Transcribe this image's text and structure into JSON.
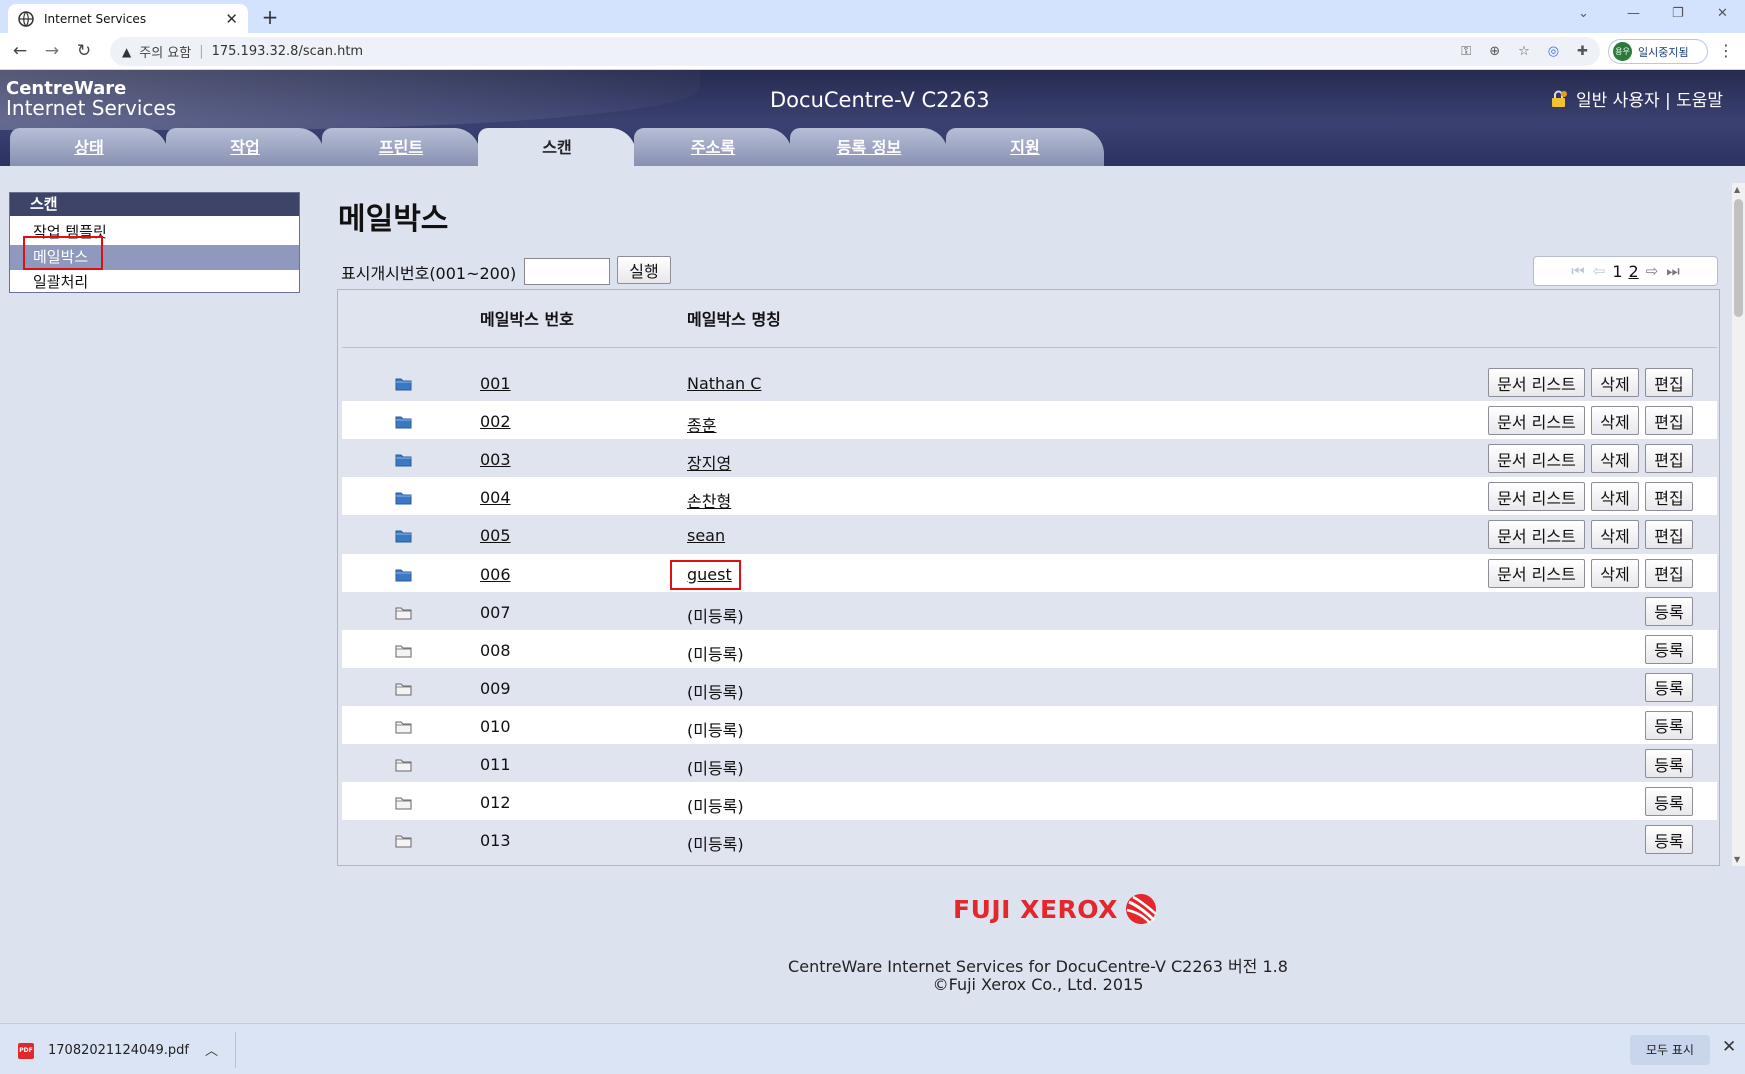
{
  "browser": {
    "tab_title": "Internet Services",
    "address_warning": "주의 요함",
    "address_separator": "|",
    "url": "175.193.32.8/scan.htm",
    "profile_initial": "용우",
    "profile_label": "일시중지됨"
  },
  "header": {
    "logo_line1": "CentreWare",
    "logo_line2": "Internet Services",
    "device_name": "DocuCentre-V C2263",
    "user_links": "일반 사용자 | 도움말"
  },
  "main_tabs": [
    {
      "label": "상태"
    },
    {
      "label": "작업"
    },
    {
      "label": "프린트"
    },
    {
      "label": "스캔"
    },
    {
      "label": "주소록"
    },
    {
      "label": "등록 정보"
    },
    {
      "label": "지원"
    }
  ],
  "active_tab": "스캔",
  "side_menu": {
    "heading": "스캔",
    "items": [
      {
        "label": "작업 템플릿"
      },
      {
        "label": "메일박스"
      },
      {
        "label": "일괄처리"
      }
    ],
    "selected": "메일박스"
  },
  "content": {
    "title": "메일박스",
    "start_label": "표시개시번호(001~200)",
    "start_value": "",
    "run_label": "실행",
    "pager": {
      "page1": "1",
      "page2": "2"
    },
    "col_number": "메일박스 번호",
    "col_name": "메일박스 명칭",
    "btn_doclist": "문서 리스트",
    "btn_delete": "삭제",
    "btn_edit": "편집",
    "btn_register": "등록",
    "rows": [
      {
        "number": "001",
        "name": "Nathan C",
        "registered": true
      },
      {
        "number": "002",
        "name": "종훈",
        "registered": true
      },
      {
        "number": "003",
        "name": "장지영",
        "registered": true
      },
      {
        "number": "004",
        "name": "손찬형",
        "registered": true
      },
      {
        "number": "005",
        "name": "sean",
        "registered": true
      },
      {
        "number": "006",
        "name": "guest",
        "registered": true
      },
      {
        "number": "007",
        "name": "(미등록)",
        "registered": false
      },
      {
        "number": "008",
        "name": "(미등록)",
        "registered": false
      },
      {
        "number": "009",
        "name": "(미등록)",
        "registered": false
      },
      {
        "number": "010",
        "name": "(미등록)",
        "registered": false
      },
      {
        "number": "011",
        "name": "(미등록)",
        "registered": false
      },
      {
        "number": "012",
        "name": "(미등록)",
        "registered": false
      },
      {
        "number": "013",
        "name": "(미등록)",
        "registered": false
      }
    ]
  },
  "footer": {
    "brand": "FUJI XEROX",
    "line1": "CentreWare Internet Services for DocuCentre-V C2263 버전 1.8",
    "line2": "©Fuji Xerox Co., Ltd. 2015"
  },
  "download_bar": {
    "file_name": "17082021124049.pdf",
    "show_all": "모두 표시"
  },
  "colors": {
    "header_navy": "#2d3360",
    "tab_inactive": "#8890b2",
    "row_shaded": "#dfe4ef",
    "highlight_red": "#e01010",
    "brand_red": "#e4262d"
  }
}
